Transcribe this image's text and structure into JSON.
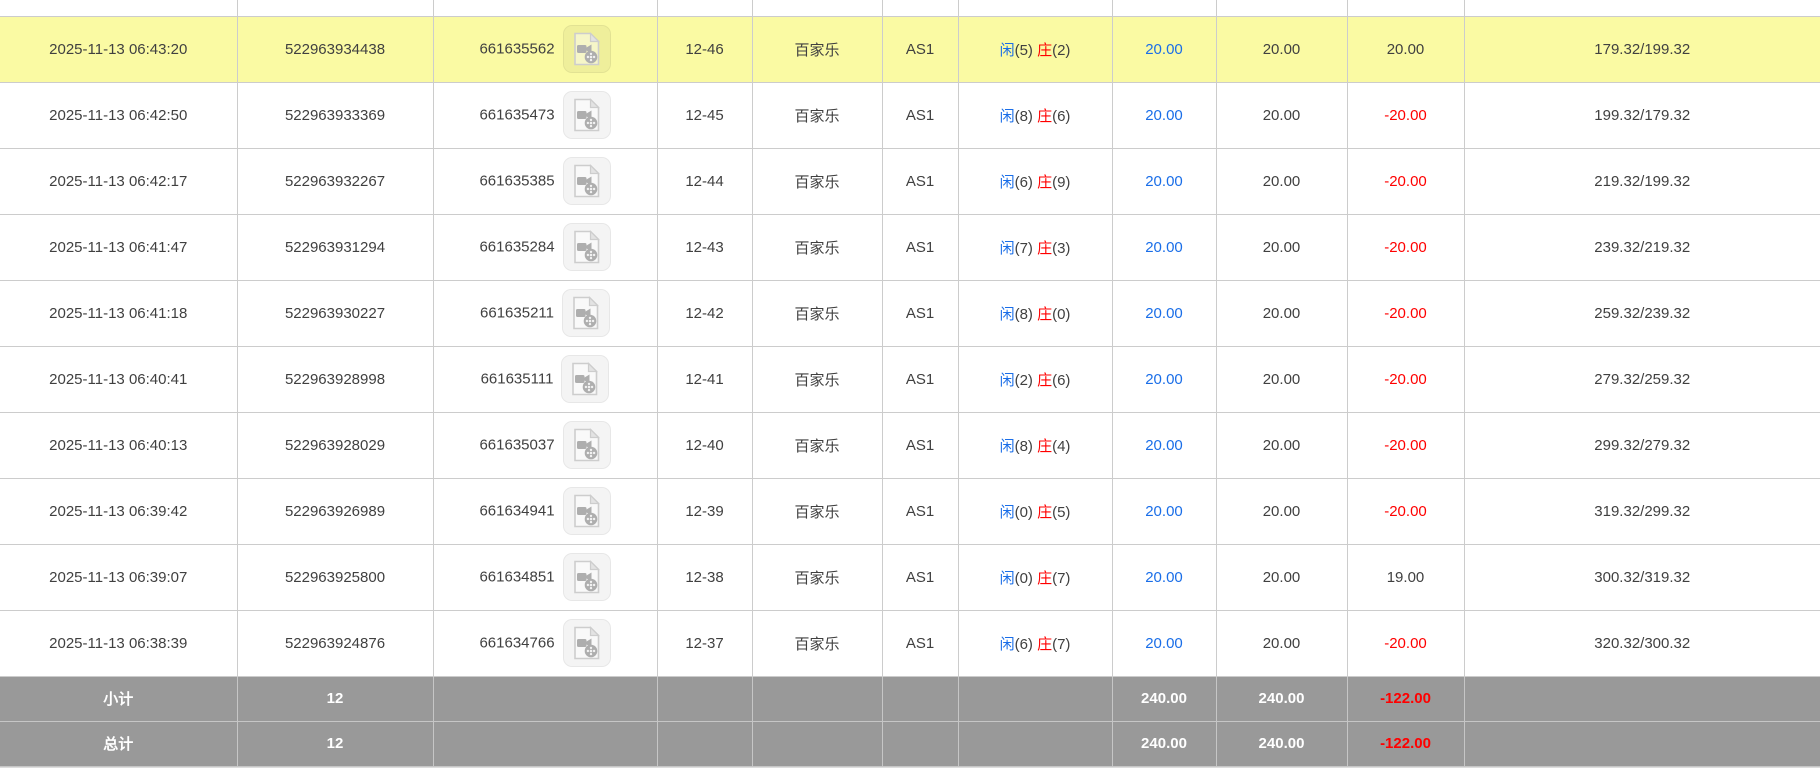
{
  "result_labels": {
    "player": "闲",
    "banker": "庄"
  },
  "rows": [
    {
      "time": "2025-11-13 06:43:20",
      "bet_id": "522963934438",
      "game_id": "661635562",
      "round": "12-46",
      "game": "百家乐",
      "table": "AS1",
      "player_num": "5",
      "banker_num": "2",
      "bet": "20.00",
      "valid": "20.00",
      "winloss": "20.00",
      "balance": "179.32/199.32",
      "highlighted": true
    },
    {
      "time": "2025-11-13 06:42:50",
      "bet_id": "522963933369",
      "game_id": "661635473",
      "round": "12-45",
      "game": "百家乐",
      "table": "AS1",
      "player_num": "8",
      "banker_num": "6",
      "bet": "20.00",
      "valid": "20.00",
      "winloss": "-20.00",
      "balance": "199.32/179.32",
      "highlighted": false
    },
    {
      "time": "2025-11-13 06:42:17",
      "bet_id": "522963932267",
      "game_id": "661635385",
      "round": "12-44",
      "game": "百家乐",
      "table": "AS1",
      "player_num": "6",
      "banker_num": "9",
      "bet": "20.00",
      "valid": "20.00",
      "winloss": "-20.00",
      "balance": "219.32/199.32",
      "highlighted": false
    },
    {
      "time": "2025-11-13 06:41:47",
      "bet_id": "522963931294",
      "game_id": "661635284",
      "round": "12-43",
      "game": "百家乐",
      "table": "AS1",
      "player_num": "7",
      "banker_num": "3",
      "bet": "20.00",
      "valid": "20.00",
      "winloss": "-20.00",
      "balance": "239.32/219.32",
      "highlighted": false
    },
    {
      "time": "2025-11-13 06:41:18",
      "bet_id": "522963930227",
      "game_id": "661635211",
      "round": "12-42",
      "game": "百家乐",
      "table": "AS1",
      "player_num": "8",
      "banker_num": "0",
      "bet": "20.00",
      "valid": "20.00",
      "winloss": "-20.00",
      "balance": "259.32/239.32",
      "highlighted": false
    },
    {
      "time": "2025-11-13 06:40:41",
      "bet_id": "522963928998",
      "game_id": "661635111",
      "round": "12-41",
      "game": "百家乐",
      "table": "AS1",
      "player_num": "2",
      "banker_num": "6",
      "bet": "20.00",
      "valid": "20.00",
      "winloss": "-20.00",
      "balance": "279.32/259.32",
      "highlighted": false
    },
    {
      "time": "2025-11-13 06:40:13",
      "bet_id": "522963928029",
      "game_id": "661635037",
      "round": "12-40",
      "game": "百家乐",
      "table": "AS1",
      "player_num": "8",
      "banker_num": "4",
      "bet": "20.00",
      "valid": "20.00",
      "winloss": "-20.00",
      "balance": "299.32/279.32",
      "highlighted": false
    },
    {
      "time": "2025-11-13 06:39:42",
      "bet_id": "522963926989",
      "game_id": "661634941",
      "round": "12-39",
      "game": "百家乐",
      "table": "AS1",
      "player_num": "0",
      "banker_num": "5",
      "bet": "20.00",
      "valid": "20.00",
      "winloss": "-20.00",
      "balance": "319.32/299.32",
      "highlighted": false
    },
    {
      "time": "2025-11-13 06:39:07",
      "bet_id": "522963925800",
      "game_id": "661634851",
      "round": "12-38",
      "game": "百家乐",
      "table": "AS1",
      "player_num": "0",
      "banker_num": "7",
      "bet": "20.00",
      "valid": "20.00",
      "winloss": "19.00",
      "balance": "300.32/319.32",
      "highlighted": false
    },
    {
      "time": "2025-11-13 06:38:39",
      "bet_id": "522963924876",
      "game_id": "661634766",
      "round": "12-37",
      "game": "百家乐",
      "table": "AS1",
      "player_num": "6",
      "banker_num": "7",
      "bet": "20.00",
      "valid": "20.00",
      "winloss": "-20.00",
      "balance": "320.32/300.32",
      "highlighted": false
    }
  ],
  "footer": [
    {
      "label": "小计",
      "count": "12",
      "bet_total": "240.00",
      "valid_total": "240.00",
      "winloss_total": "-122.00"
    },
    {
      "label": "总计",
      "count": "12",
      "bet_total": "240.00",
      "valid_total": "240.00",
      "winloss_total": "-122.00"
    }
  ],
  "icons": {
    "video": "video-replay-icon"
  },
  "colors": {
    "highlight_yellow": "#fafaa3",
    "link_blue": "#1a6ee8",
    "negative_red": "#ff0000",
    "footer_gray": "#999999",
    "border_gray": "#cccccc"
  }
}
